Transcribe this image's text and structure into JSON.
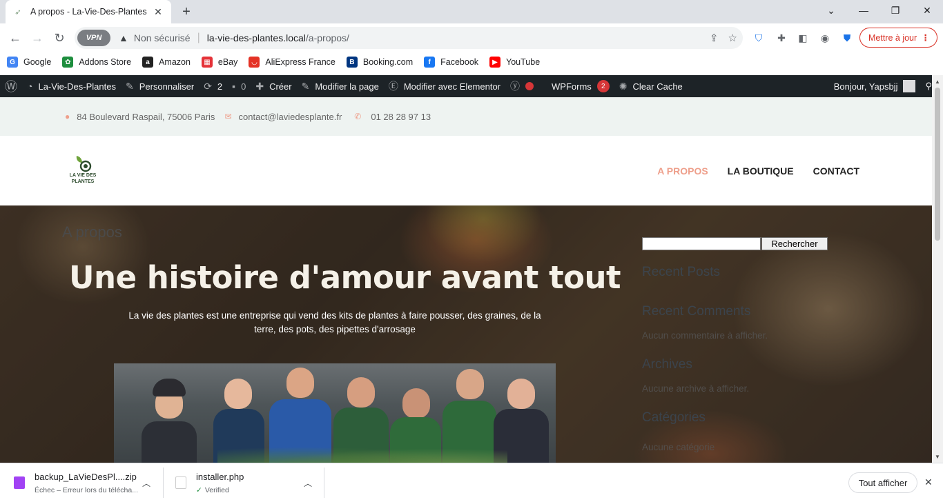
{
  "browser": {
    "tab": {
      "title": "A propos - La-Vie-Des-Plantes"
    },
    "address": {
      "vpn_label": "VPN",
      "security": "Non sécurisé",
      "host": "la-vie-des-plantes.local",
      "path": "/a-propos/"
    },
    "update_button": "Mettre à jour",
    "bookmarks": [
      {
        "label": "Google",
        "color": "#4285f4",
        "glyph": "G"
      },
      {
        "label": "Addons Store",
        "color": "#1e8e3e",
        "glyph": "✿"
      },
      {
        "label": "Amazon",
        "color": "#222222",
        "glyph": "a"
      },
      {
        "label": "eBay",
        "color": "#e53238",
        "glyph": "▦"
      },
      {
        "label": "AliExpress France",
        "color": "#e43225",
        "glyph": "◡"
      },
      {
        "label": "Booking.com",
        "color": "#003580",
        "glyph": "B"
      },
      {
        "label": "Facebook",
        "color": "#1877f2",
        "glyph": "f"
      },
      {
        "label": "YouTube",
        "color": "#ff0000",
        "glyph": "▶"
      }
    ]
  },
  "adminbar": {
    "site": "La-Vie-Des-Plantes",
    "customize": "Personnaliser",
    "updates": "2",
    "comments": "0",
    "new": "Créer",
    "edit_page": "Modifier la page",
    "elementor": "Modifier avec Elementor",
    "wpforms": "WPForms",
    "wpforms_count": "2",
    "clear_cache": "Clear Cache",
    "greeting": "Bonjour, Yapsbjj"
  },
  "contact": {
    "address": "84 Boulevard Raspail, 75006 Paris",
    "email": "contact@laviedesplante.fr",
    "phone": "01 28 28 97 13"
  },
  "header": {
    "logo_line1": "LA VIE DES",
    "logo_line2": "PLANTES",
    "nav": [
      "A PROPOS",
      "LA BOUTIQUE",
      "CONTACT"
    ]
  },
  "hero": {
    "page_title": "A propos",
    "heading": "Une histoire d'amour avant tout",
    "subtitle": "La vie des plantes est une entreprise qui vend des kits de plantes à faire pousser, des graines, de la terre, des pots, des pipettes d'arrosage"
  },
  "sidebar": {
    "search_button": "Rechercher",
    "recent_posts": "Recent Posts",
    "recent_comments": "Recent Comments",
    "no_comments": "Aucun commentaire à afficher.",
    "archives": "Archives",
    "no_archives": "Aucune archive à afficher.",
    "categories": "Catégories",
    "no_categories": "Aucune catégorie"
  },
  "downloads": [
    {
      "name": "backup_LaVieDesPl....zip",
      "status": "Échec – Erreur lors du télécha...",
      "color": "#a142f4"
    },
    {
      "name": "installer.php",
      "status": "Verified",
      "color": "#8e7cc3"
    }
  ],
  "downloads_show_all": "Tout afficher"
}
